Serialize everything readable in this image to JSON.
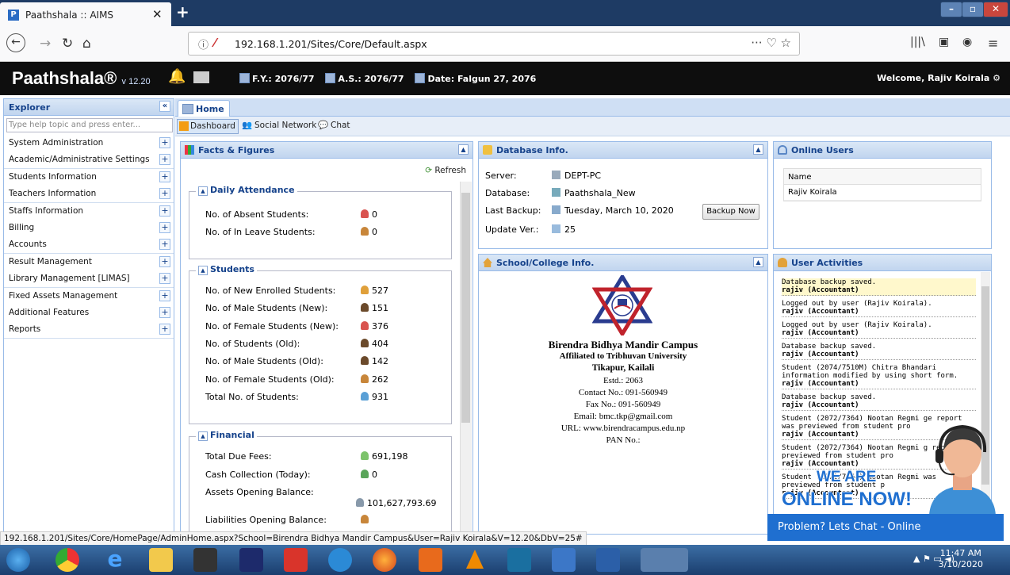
{
  "browser": {
    "tab_title": "Paathshala :: AIMS",
    "tab_favicon": "P",
    "url": "192.168.1.201/Sites/Core/Default.aspx",
    "nav_icons": [
      "back-icon",
      "forward-icon",
      "reload-icon",
      "home-icon"
    ],
    "right_icons": [
      "more-icon",
      "pocket-icon",
      "bookmark-star-icon",
      "library-icon",
      "sidebar-icon",
      "account-icon",
      "menu-icon"
    ]
  },
  "app": {
    "brand": "Paathshala®",
    "version": "v 12.20",
    "fy": "F.Y.: 2076/77",
    "as": "A.S.: 2076/77",
    "date": "Date: Falgun 27, 2076",
    "welcome": "Welcome, Rajiv Koirala"
  },
  "explorer": {
    "title": "Explorer",
    "search_placeholder": "Type help topic and press enter...",
    "items": [
      "System Administration",
      "Academic/Administrative Settings",
      "Students Information",
      "Teachers Information",
      "Staffs Information",
      "Billing",
      "Accounts",
      "Result Management",
      "Library Management [LIMAS]",
      "Fixed Assets Management",
      "Additional Features",
      "Reports"
    ]
  },
  "tabs": {
    "home": "Home",
    "dashboard": "Dashboard",
    "social": "Social Network",
    "chat": "Chat"
  },
  "facts": {
    "title": "Facts & Figures",
    "refresh": "Refresh",
    "attendance": {
      "legend": "Daily Attendance",
      "rows": [
        {
          "label": "No. of Absent Students:",
          "value": "0"
        },
        {
          "label": "No. of In Leave Students:",
          "value": "0"
        }
      ]
    },
    "students": {
      "legend": "Students",
      "rows": [
        {
          "label": "No. of New Enrolled Students:",
          "value": "527"
        },
        {
          "label": "No. of Male Students (New):",
          "value": "151"
        },
        {
          "label": "No. of Female Students (New):",
          "value": "376"
        },
        {
          "label": "No. of Students (Old):",
          "value": "404"
        },
        {
          "label": "No. of Male Students (Old):",
          "value": "142"
        },
        {
          "label": "No. of Female Students (Old):",
          "value": "262"
        },
        {
          "label": "Total No. of Students:",
          "value": "931"
        }
      ]
    },
    "financial": {
      "legend": "Financial",
      "rows": [
        {
          "label": "Total Due Fees:",
          "value": "691,198"
        },
        {
          "label": "Cash Collection (Today):",
          "value": "0"
        },
        {
          "label": "Assets Opening Balance:",
          "value": "101,627,793.69"
        },
        {
          "label": "Liabilities Opening Balance:",
          "value": ""
        }
      ]
    }
  },
  "db": {
    "title": "Database Info.",
    "server_label": "Server:",
    "server": "DEPT-PC",
    "database_label": "Database:",
    "database": "Paathshala_New",
    "backup_label": "Last Backup:",
    "backup": "Tuesday, March 10, 2020",
    "update_label": "Update Ver.:",
    "update": "25",
    "backup_button": "Backup Now"
  },
  "school": {
    "title": "School/College Info.",
    "name": "Birendra Bidhya Mandir Campus",
    "affiliation": "Affiliated to Tribhuvan University",
    "address": "Tikapur, Kailali",
    "estd": "Estd.: 2063",
    "contact": "Contact No.: 091-560949",
    "fax": "Fax No.: 091-560949",
    "email": "Email: bmc.tkp@gmail.com",
    "url": "URL: www.birendracampus.edu.np",
    "pan": "PAN No.:"
  },
  "online_users": {
    "title": "Online Users",
    "column": "Name",
    "users": [
      "Rajiv Koirala"
    ]
  },
  "activities": {
    "title": "User Activities",
    "items": [
      {
        "text": "Database backup saved.",
        "user": "rajiv (Accountant)"
      },
      {
        "text": "Logged out by user (Rajiv Koirala).",
        "user": "rajiv (Accountant)"
      },
      {
        "text": "Logged out by user (Rajiv Koirala).",
        "user": "rajiv (Accountant)"
      },
      {
        "text": "Database backup saved.",
        "user": "rajiv (Accountant)"
      },
      {
        "text": "Student (2074/7510M) Chitra Bhandari information modified by using short form.",
        "user": "rajiv (Accountant)"
      },
      {
        "text": "Database backup saved.",
        "user": "rajiv (Accountant)"
      },
      {
        "text": "Student (2072/7364) Nootan Regmi ge report was previewed from student pro",
        "user": "rajiv (Accountant)"
      },
      {
        "text": "Student (2072/7364) Nootan Regmi g report was previewed from student pro",
        "user": "rajiv (Accountant)"
      },
      {
        "text": "Student (2072/7364) Nootan Regmi was previewed from student p",
        "user": "rajiv (Accountant)"
      }
    ]
  },
  "chat_widget": {
    "line1": "WE ARE",
    "line2": "ONLINE NOW!",
    "bar": "Problem? Lets Chat - Online"
  },
  "status_url": "192.168.1.201/Sites/Core/HomePage/AdminHome.aspx?School=Birendra Bidhya Mandir Campus&User=Rajiv Koirala&V=12.20&DbV=25#",
  "taskbar": {
    "time": "11:47 AM",
    "date": "3/10/2020"
  }
}
